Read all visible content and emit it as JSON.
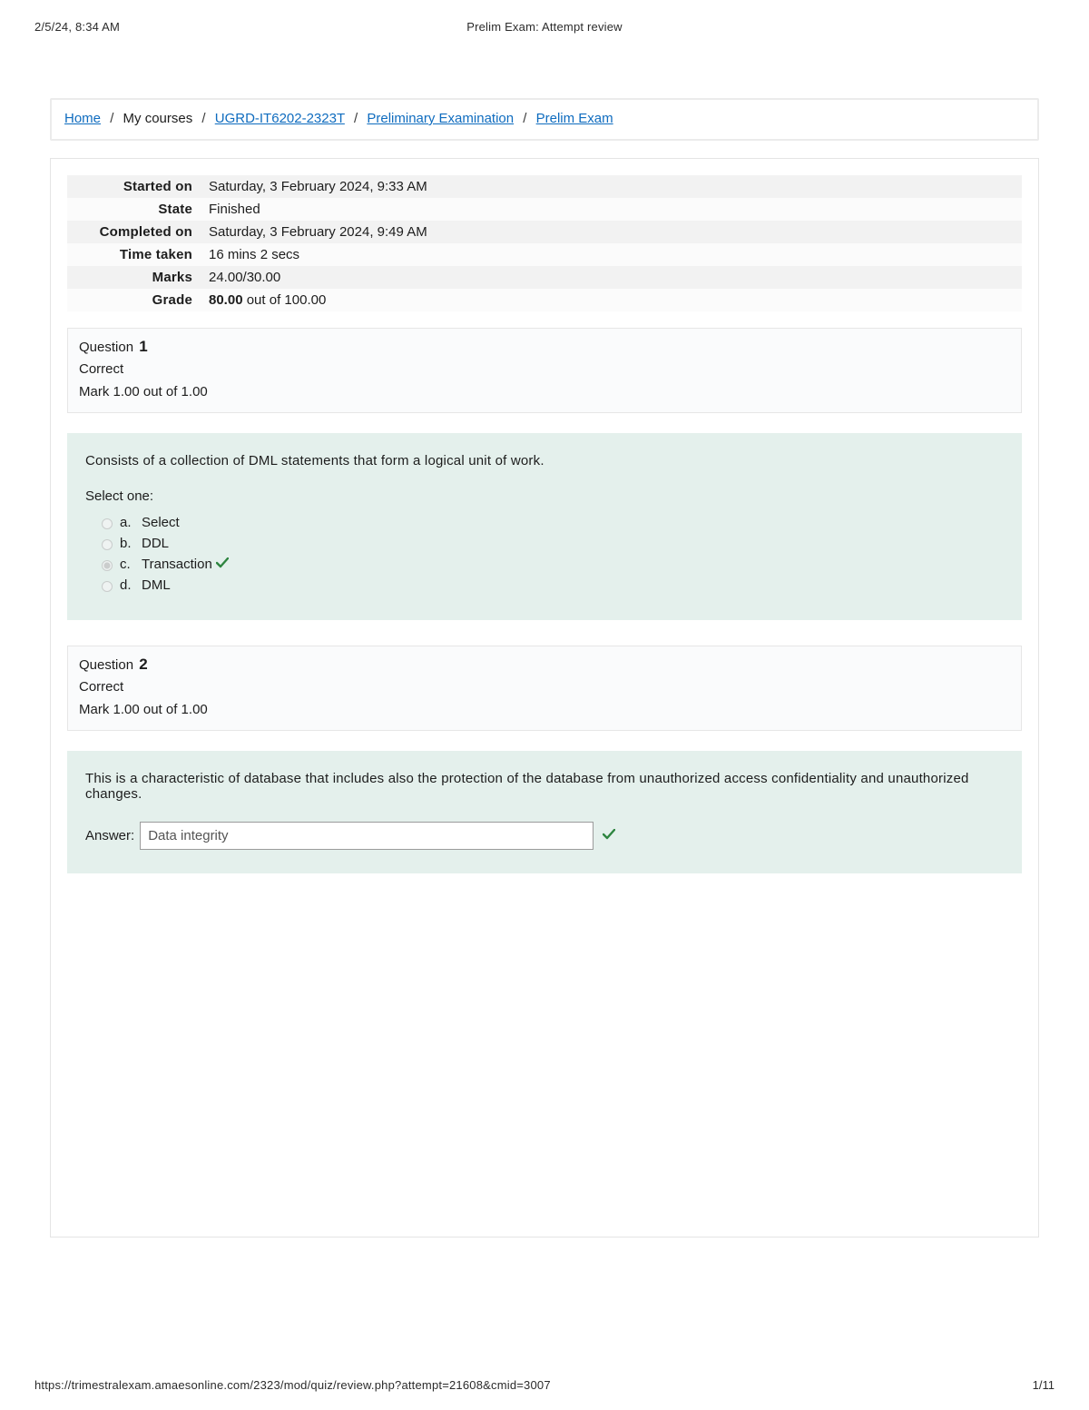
{
  "print": {
    "datetime": "2/5/24, 8:34 AM",
    "title": "Prelim Exam: Attempt review",
    "url": "https://trimestralexam.amaesonline.com/2323/mod/quiz/review.php?attempt=21608&cmid=3007",
    "page": "1/11"
  },
  "breadcrumb": {
    "home": "Home",
    "my_courses": "My courses",
    "course": "UGRD-IT6202-2323T",
    "section": "Preliminary Examination",
    "item": "Prelim Exam"
  },
  "summary": {
    "started_on_label": "Started on",
    "started_on": "Saturday, 3 February 2024, 9:33 AM",
    "state_label": "State",
    "state": "Finished",
    "completed_on_label": "Completed on",
    "completed_on": "Saturday, 3 February 2024, 9:49 AM",
    "time_taken_label": "Time taken",
    "time_taken": "16 mins 2 secs",
    "marks_label": "Marks",
    "marks": "24.00/30.00",
    "grade_label": "Grade",
    "grade_value": "80.00",
    "grade_suffix": " out of 100.00"
  },
  "q1": {
    "label": "Question",
    "number": "1",
    "state": "Correct",
    "mark": "Mark 1.00 out of 1.00",
    "prompt": "Consists of a collection of DML statements that form a logical unit of work.",
    "select_one": "Select one:",
    "options": {
      "a": {
        "letter": "a.",
        "text": "Select",
        "checked": false,
        "correct": false
      },
      "b": {
        "letter": "b.",
        "text": "DDL",
        "checked": false,
        "correct": false
      },
      "c": {
        "letter": "c.",
        "text": "Transaction",
        "checked": true,
        "correct": true
      },
      "d": {
        "letter": "d.",
        "text": "DML",
        "checked": false,
        "correct": false
      }
    }
  },
  "q2": {
    "label": "Question",
    "number": "2",
    "state": "Correct",
    "mark": "Mark 1.00 out of 1.00",
    "prompt": "This is a characteristic of database that includes also the protection of the database from unauthorized access confidentiality and unauthorized changes.",
    "answer_label": "Answer:",
    "answer_value": "Data integrity",
    "correct": true
  }
}
